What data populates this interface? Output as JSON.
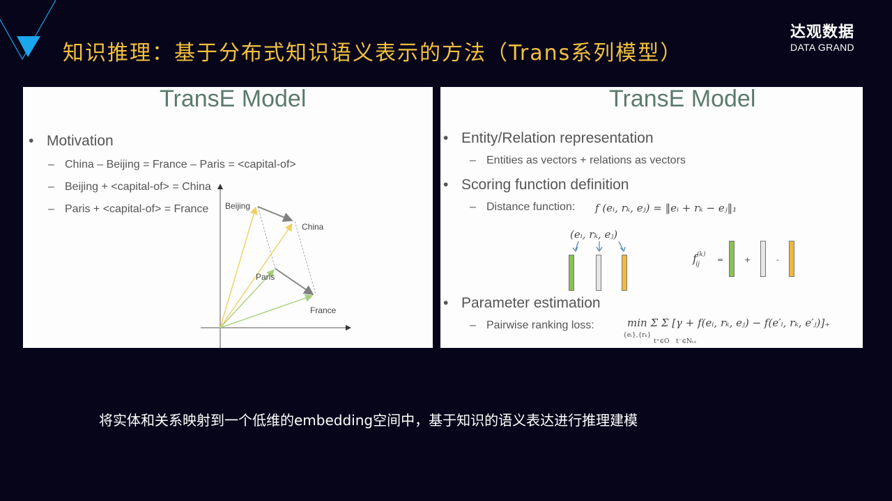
{
  "header": {
    "title": "知识推理：基于分布式知识语义表示的方法（Trans系列模型）",
    "logo_cn": "达观数据",
    "logo_en": "DATA GRAND"
  },
  "colors": {
    "background": "#07051a",
    "title": "#f3c13d",
    "accent_triangle": "#1aa7ec",
    "slide_title": "#5b7a6c",
    "vector_yellow": "#f0d060",
    "vector_green": "#a8cf7a",
    "vector_gray": "#808080",
    "bar_green": "#8cc152",
    "bar_gray": "#d8d8d8",
    "bar_orange": "#f0b93b"
  },
  "left_slide": {
    "title": "TransE Model",
    "bullet": "Motivation",
    "subs": [
      "China – Beijing = France – Paris = <capital-of>",
      "Beijing + <capital-of> = China",
      "Paris + <capital-of> = France"
    ],
    "diagram": {
      "labels": [
        "Beijing",
        "China",
        "Paris",
        "France"
      ]
    }
  },
  "right_slide": {
    "title": "TransE Model",
    "bullets": [
      {
        "label": "Entity/Relation representation",
        "sub": "Entities as vectors + relations as vectors"
      },
      {
        "label": "Scoring function definition",
        "sub": "Distance function:",
        "formula": "f (eᵢ, rₖ, eⱼ) = ‖eᵢ + rₖ − eⱼ‖₁"
      },
      {
        "label": "Parameter estimation",
        "sub": "Pairwise ranking loss:",
        "formula": "min Σ Σ [γ + f(eᵢ, rₖ, eⱼ) − f(e′ᵢ, rₖ, e′ⱼ)]₊",
        "formula_under_min": "{eᵢ},{rₖ}",
        "formula_under_sum1": "t⁺∈O",
        "formula_under_sum2": "t⁻∈Nₜ₊"
      }
    ],
    "triple_label": "(eᵢ, rₖ, eⱼ)",
    "fij_label": "f",
    "fij_sup": "(k)",
    "fij_sub": "ij",
    "op_eq": "=",
    "op_plus": "+",
    "op_minus": "-"
  },
  "caption": "将实体和关系映射到一个低维的embedding空间中，基于知识的语义表达进行推理建模"
}
